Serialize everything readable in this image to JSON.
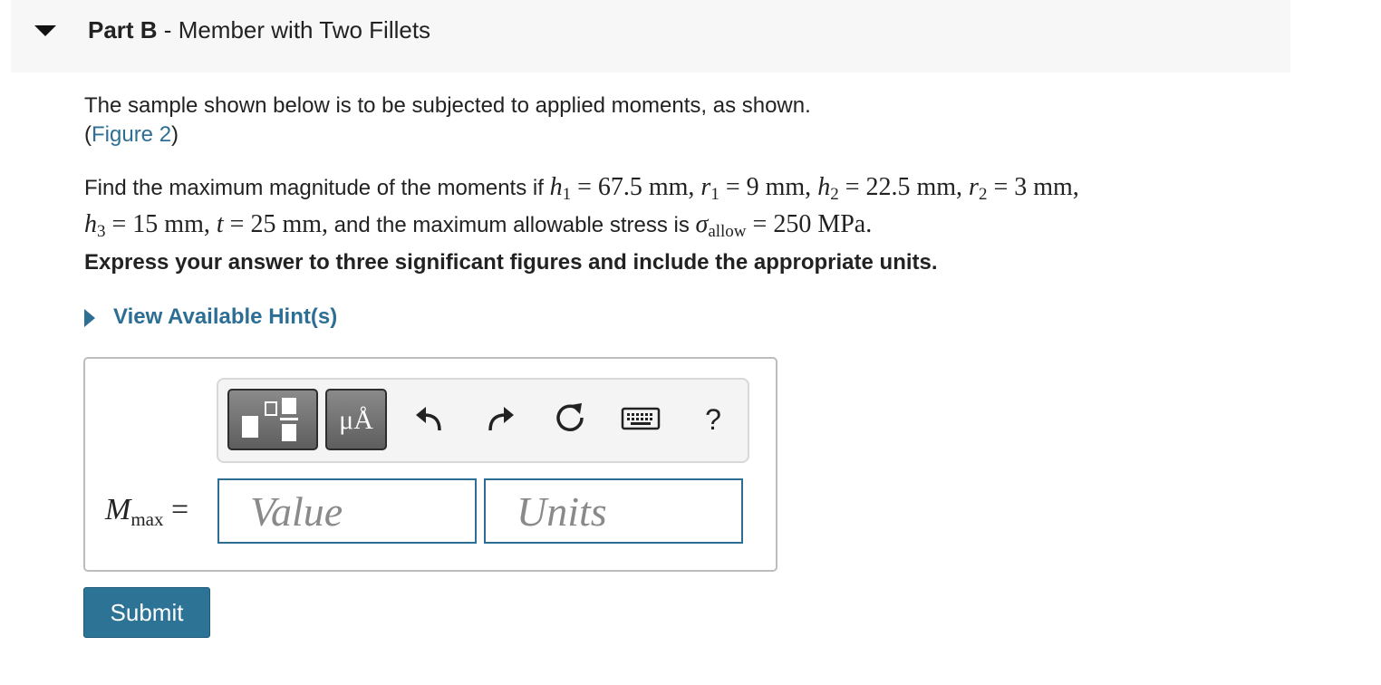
{
  "part": {
    "label": "Part B",
    "separator": " - ",
    "title": "Member with Two Fillets"
  },
  "intro": {
    "text": "The sample shown below is to be subjected to applied moments, as shown.",
    "figure_open": "(",
    "figure_link": "Figure 2",
    "figure_close": ")"
  },
  "problem": {
    "lead": "Find the maximum magnitude of the moments if ",
    "h1": {
      "var": "h",
      "sub": "1",
      "value": "67.5 mm,"
    },
    "r1": {
      "var": "r",
      "sub": "1",
      "value": "9 mm,"
    },
    "h2": {
      "var": "h",
      "sub": "2",
      "value": "22.5 mm,"
    },
    "r2": {
      "var": "r",
      "sub": "2",
      "value": "3 mm,"
    },
    "h3": {
      "var": "h",
      "sub": "3",
      "value": "15 mm,"
    },
    "t": {
      "var": "t",
      "value": "25 mm,"
    },
    "mid": " and the maximum allowable stress is ",
    "sigma": {
      "var": "σ",
      "sub": "allow",
      "value": "250 MPa."
    },
    "equals": "="
  },
  "instruction": "Express your answer to three significant figures and include the appropriate units.",
  "hints": {
    "label": "View Available Hint(s)"
  },
  "toolbar": {
    "templates_icon": "fraction-templates-icon",
    "units_label": "μÅ",
    "undo_icon": "undo-icon",
    "redo_icon": "redo-icon",
    "reset_icon": "reset-icon",
    "keyboard_icon": "keyboard-icon",
    "help_label": "?"
  },
  "answer": {
    "lhs_var": "M",
    "lhs_sub": "max",
    "equals": "=",
    "value_placeholder": "Value",
    "units_placeholder": "Units",
    "value": "",
    "units": ""
  },
  "submit": {
    "label": "Submit"
  },
  "colors": {
    "link": "#2d6f94",
    "submit": "#2d7396",
    "header_bg": "#f7f7f7"
  }
}
